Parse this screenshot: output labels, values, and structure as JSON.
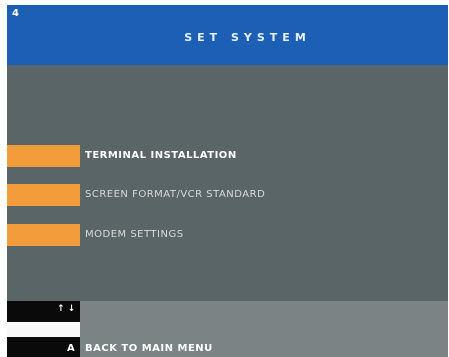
{
  "header": {
    "page_number": "4",
    "title": "SET SYSTEM"
  },
  "menu": {
    "items": [
      {
        "label": "TERMINAL INSTALLATION",
        "selected": true
      },
      {
        "label": "SCREEN FORMAT/VCR STANDARD",
        "selected": false
      },
      {
        "label": "MODEM SETTINGS",
        "selected": false
      }
    ]
  },
  "footer": {
    "arrows": "↑ ↓",
    "back_key": "A",
    "back_label": "BACK TO MAIN MENU"
  },
  "colors": {
    "header_bg": "#1d5fb4",
    "screen_bg": "#596567",
    "menu_bar": "#f39c3c",
    "footer_bg": "#7a8485"
  }
}
